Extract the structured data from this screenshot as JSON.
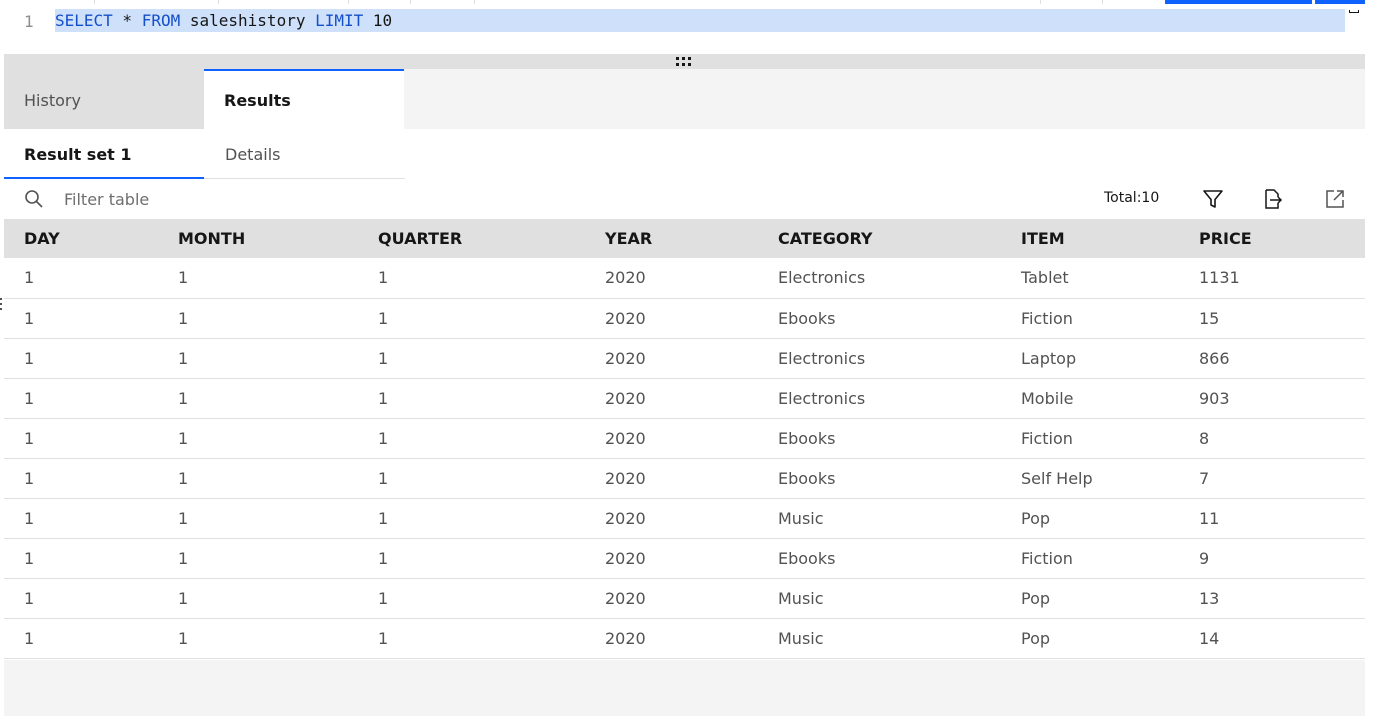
{
  "editor": {
    "line_number": "1",
    "query_tokens": [
      {
        "text": "SELECT",
        "kind": "kw"
      },
      {
        "text": " * ",
        "kind": "plain"
      },
      {
        "text": "FROM",
        "kind": "kw"
      },
      {
        "text": " saleshistory ",
        "kind": "plain"
      },
      {
        "text": "LIMIT",
        "kind": "kw"
      },
      {
        "text": " 10",
        "kind": "plain"
      }
    ]
  },
  "tabs": [
    {
      "label": "History",
      "active": false
    },
    {
      "label": "Results",
      "active": true
    }
  ],
  "subtabs": [
    {
      "label": "Result set 1",
      "active": true
    },
    {
      "label": "Details",
      "active": false
    }
  ],
  "toolbar": {
    "filter_placeholder": "Filter table",
    "total_label": "Total:10"
  },
  "table": {
    "columns": [
      "DAY",
      "MONTH",
      "QUARTER",
      "YEAR",
      "CATEGORY",
      "ITEM",
      "PRICE"
    ],
    "rows": [
      [
        "1",
        "1",
        "1",
        "2020",
        "Electronics",
        "Tablet",
        "1131"
      ],
      [
        "1",
        "1",
        "1",
        "2020",
        "Ebooks",
        "Fiction",
        "15"
      ],
      [
        "1",
        "1",
        "1",
        "2020",
        "Electronics",
        "Laptop",
        "866"
      ],
      [
        "1",
        "1",
        "1",
        "2020",
        "Electronics",
        "Mobile",
        "903"
      ],
      [
        "1",
        "1",
        "1",
        "2020",
        "Ebooks",
        "Fiction",
        "8"
      ],
      [
        "1",
        "1",
        "1",
        "2020",
        "Ebooks",
        "Self Help",
        "7"
      ],
      [
        "1",
        "1",
        "1",
        "2020",
        "Music",
        "Pop",
        "11"
      ],
      [
        "1",
        "1",
        "1",
        "2020",
        "Ebooks",
        "Fiction",
        "9"
      ],
      [
        "1",
        "1",
        "1",
        "2020",
        "Music",
        "Pop",
        "13"
      ],
      [
        "1",
        "1",
        "1",
        "2020",
        "Music",
        "Pop",
        "14"
      ]
    ]
  },
  "colors": {
    "accent": "#0f62fe",
    "keyword": "#1450c9",
    "selection": "#cfe0fa",
    "header_bg": "#e0e0e0"
  },
  "icons": [
    "search-icon",
    "filter-icon",
    "export-icon",
    "open-external-icon",
    "resize-grip-icon"
  ]
}
